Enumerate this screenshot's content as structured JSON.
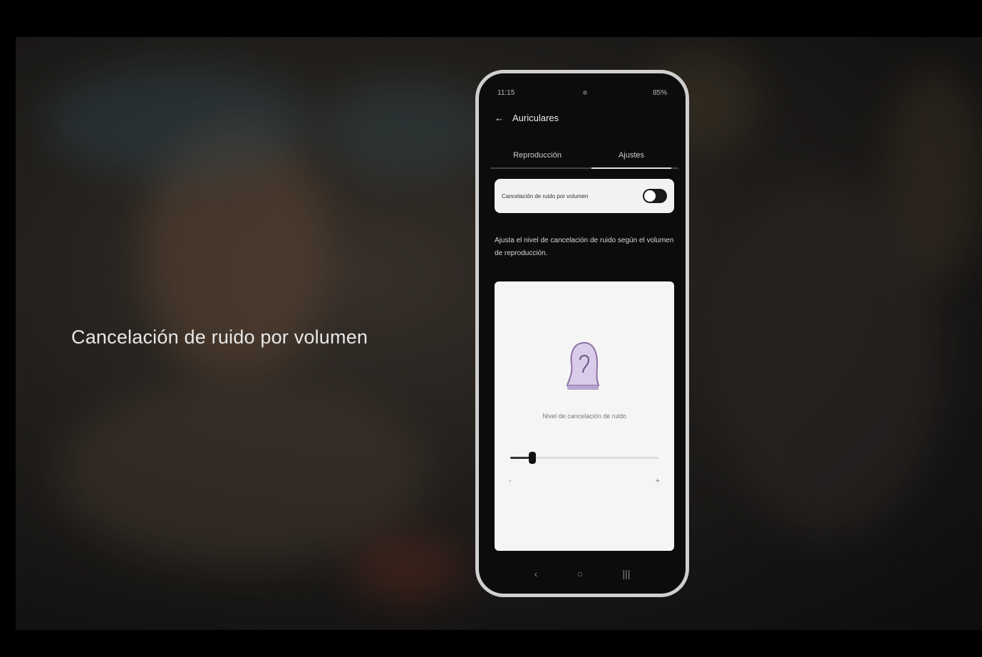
{
  "video": {
    "caption": "Cancelación de ruido por volumen"
  },
  "phone": {
    "status_left": "11:15",
    "status_right": "85%",
    "header_title": "Auriculares",
    "tabs": [
      {
        "label": "Reproducción"
      },
      {
        "label": "Ajustes"
      }
    ],
    "toggle_label": "Cancelación de ruido por volumen",
    "description": "Ajusta el nivel de cancelación de ruido según el volumen de reproducción.",
    "card_text": "Nivel de cancelación de ruido",
    "slider": {
      "value_fraction": 0.15,
      "min_label": "-",
      "max_label": "+"
    },
    "toggle_on": true,
    "nav": {
      "back": "‹",
      "home": "○",
      "recents": "|||"
    }
  }
}
